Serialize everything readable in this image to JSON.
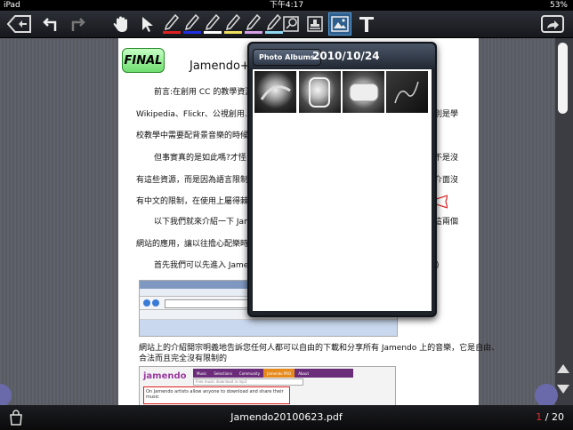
{
  "status": {
    "device": "iPad",
    "time": "下午4:17",
    "battery": "53%"
  },
  "document": {
    "badge": "FINAL",
    "title": "Jamendo+di",
    "lines": [
      "前言:在創用 CC 的教學資源",
      "Wikipedia、Flickr、公視創用......",
      "別是學",
      "校教學中需要配背景音樂的時候，",
      "但事實真的是如此嗎?才怪，",
      "不是沒",
      "有這些資源，而是因為語言限制住",
      "介面沒",
      "有中文的限制，在使用上屬得棘手",
      "以下我們就來介紹一下 Jame",
      "這兩個",
      "網站的應用，讓以往擔心配樂時找",
      "首先我們可以先進入 Jamend",
      "網站上的介紹開宗明義地告訴您任何人都可以自由的下載和分享所有 Jamendo 上的音樂，它是自由、",
      "合法而且完全沒有限制的"
    ],
    "screenshot2": {
      "brand": "jamendo",
      "tabs": [
        "Music",
        "Selections",
        "Community",
        "Jamendo PRO",
        "About"
      ],
      "search": "Free music download in mp3",
      "headline": "On Jamendo artists allow anyone to download and share their music"
    }
  },
  "popover": {
    "albums_button": "Photo Albums",
    "title": "2010/10/24",
    "thumbnails": [
      "photo-1",
      "photo-2",
      "photo-3",
      "photo-4"
    ]
  },
  "bottom": {
    "filename": "Jamendo20100623.pdf",
    "current_page": "1",
    "total_pages": "/ 20"
  }
}
